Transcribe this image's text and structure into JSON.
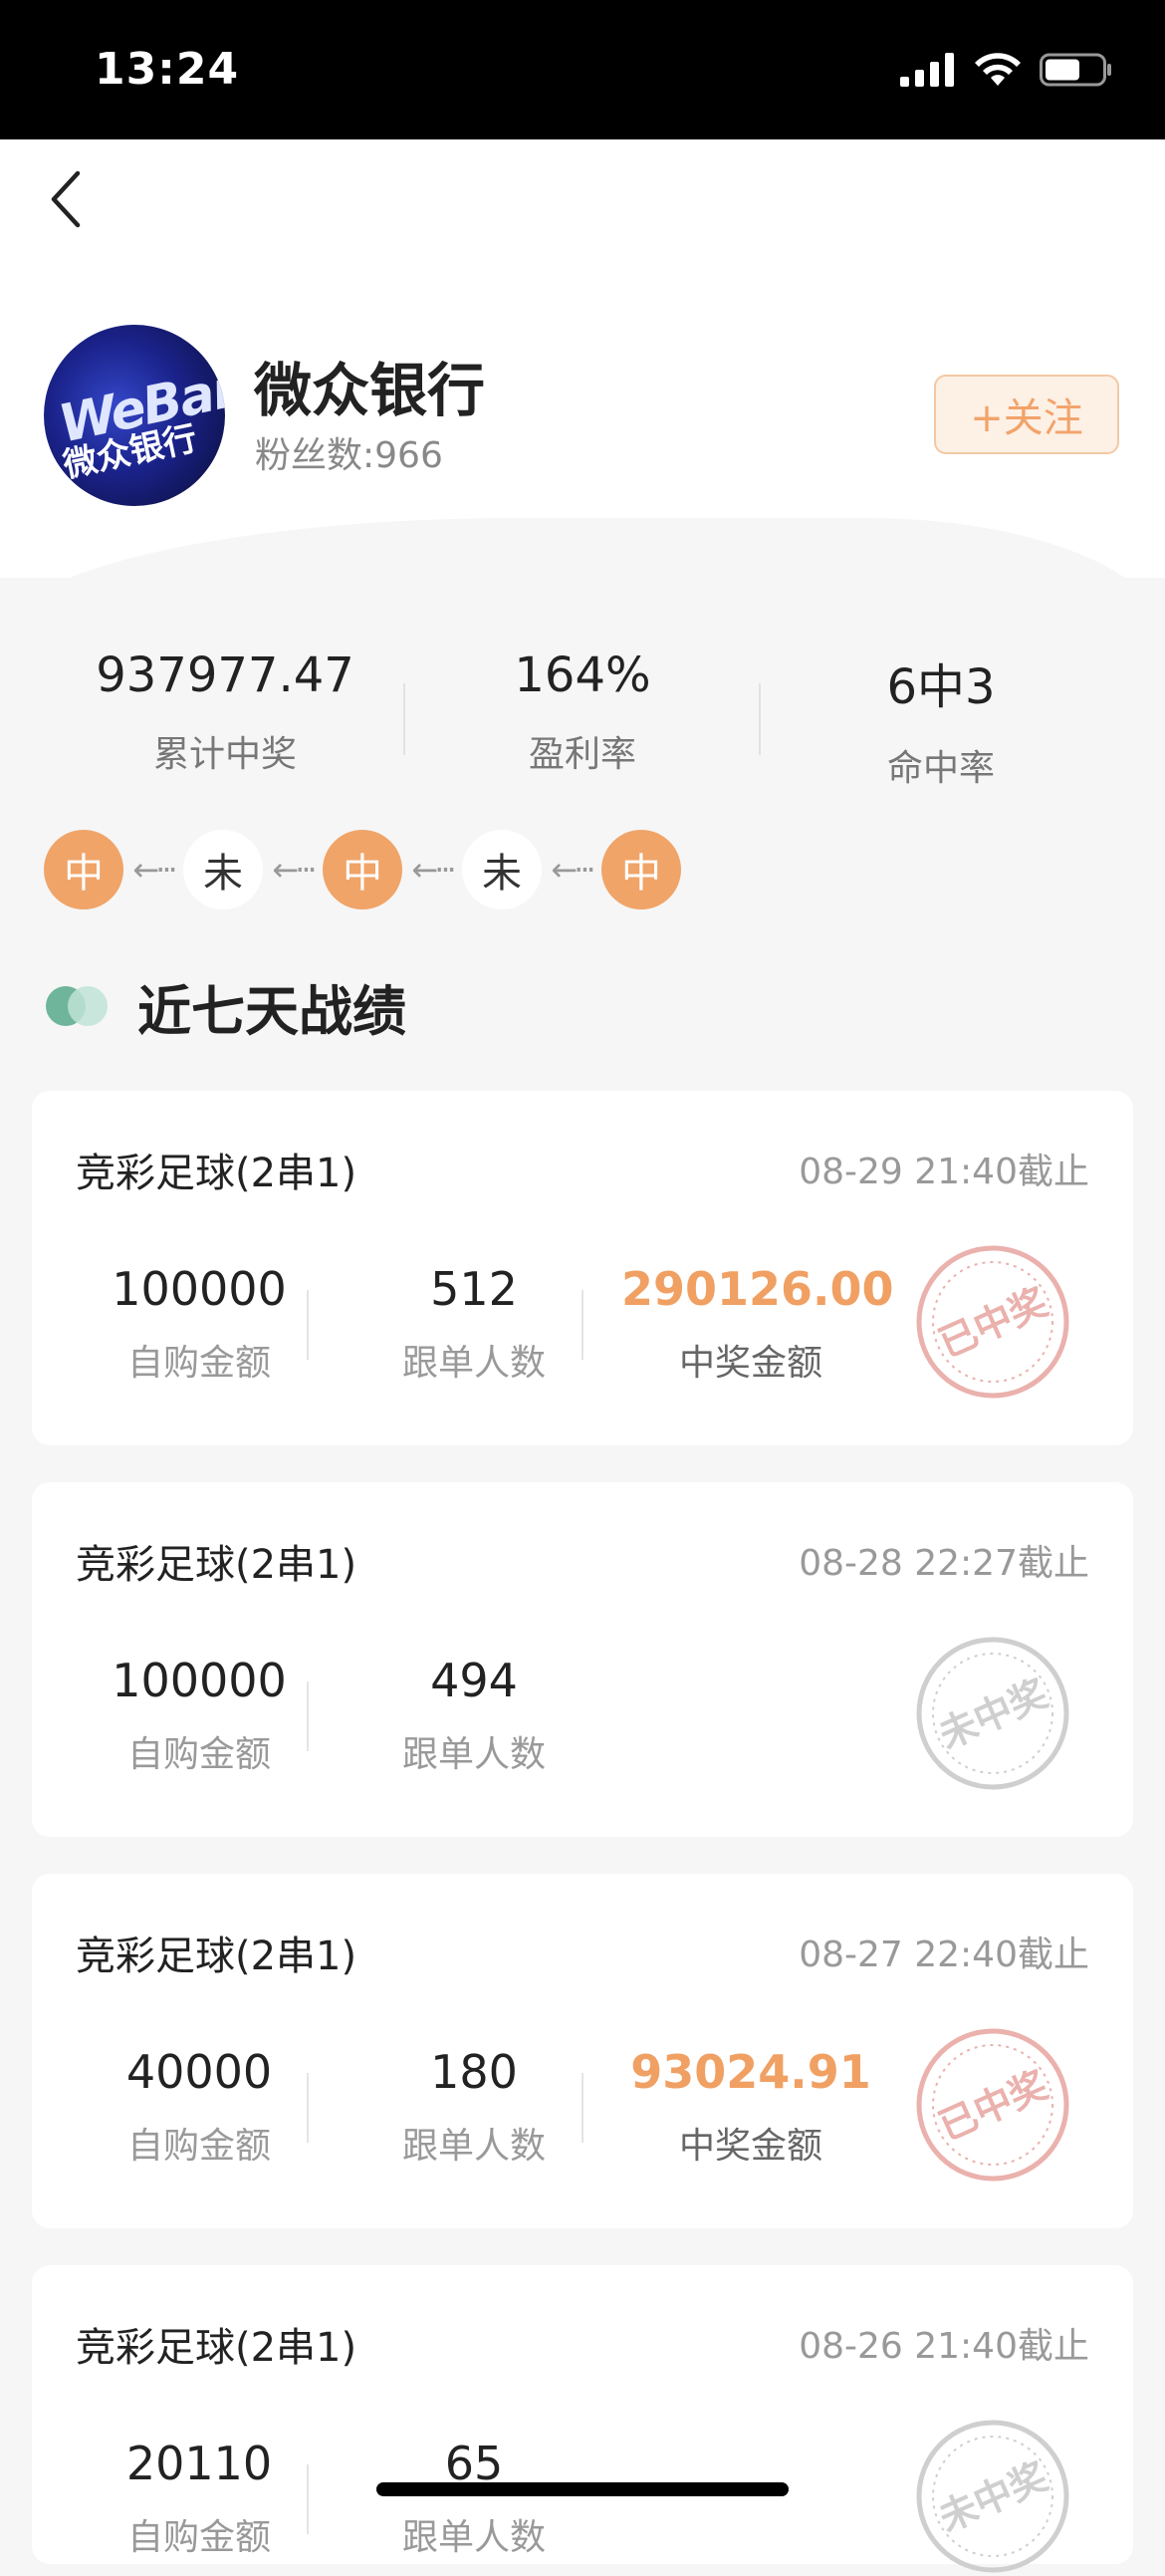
{
  "status_bar": {
    "time": "13:24"
  },
  "profile": {
    "name": "微众银行",
    "fans": "粉丝数:966",
    "follow_label": "+关注",
    "avatar_logo": "WeBank",
    "avatar_cn": "微众银行"
  },
  "stats": [
    {
      "value": "937977.47",
      "label": "累计中奖"
    },
    {
      "value": "164%",
      "label": "盈利率"
    },
    {
      "value": "6中3",
      "label": "命中率"
    }
  ],
  "history": [
    {
      "text": "中",
      "status": "win"
    },
    {
      "text": "未",
      "status": "lose"
    },
    {
      "text": "中",
      "status": "win"
    },
    {
      "text": "未",
      "status": "lose"
    },
    {
      "text": "中",
      "status": "win"
    }
  ],
  "history_arrow": "←···",
  "section_title": "近七天战绩",
  "records": [
    {
      "type": "竞彩足球(2串1)",
      "deadline": "08-29 21:40截止",
      "self_amount": "100000",
      "self_amount_label": "自购金额",
      "followers": "512",
      "followers_label": "跟单人数",
      "prize": "290126.00",
      "prize_label": "中奖金额",
      "stamp": "已中奖"
    },
    {
      "type": "竞彩足球(2串1)",
      "deadline": "08-28 22:27截止",
      "self_amount": "100000",
      "self_amount_label": "自购金额",
      "followers": "494",
      "followers_label": "跟单人数",
      "stamp": "未中奖"
    },
    {
      "type": "竞彩足球(2串1)",
      "deadline": "08-27 22:40截止",
      "self_amount": "40000",
      "self_amount_label": "自购金额",
      "followers": "180",
      "followers_label": "跟单人数",
      "prize": "93024.91",
      "prize_label": "中奖金额",
      "stamp": "已中奖"
    },
    {
      "type": "竞彩足球(2串1)",
      "deadline": "08-26 21:40截止",
      "self_amount": "20110",
      "self_amount_label": "自购金额",
      "followers": "65",
      "followers_label": "跟单人数",
      "stamp": "未中奖"
    }
  ],
  "colors": {
    "accent": "#f0a468",
    "win_stamp": "#e9a7a2",
    "lose_stamp": "#c9c9c9",
    "section_icon": "#6fb59b"
  }
}
